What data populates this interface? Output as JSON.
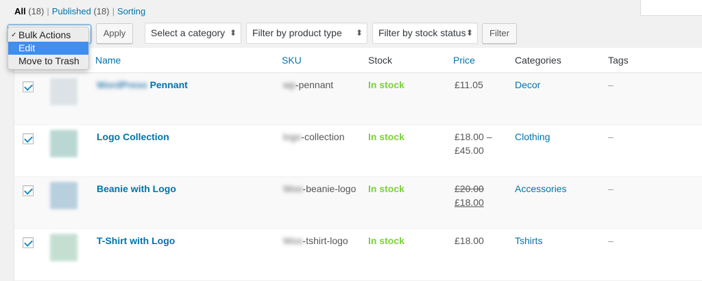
{
  "status_links": [
    {
      "label": "All",
      "count": "(18)",
      "current": true
    },
    {
      "label": "Published",
      "count": "(18)",
      "current": false
    },
    {
      "label": "Sorting",
      "count": "",
      "current": false
    }
  ],
  "toolbar": {
    "bulk_actions": {
      "options": [
        "Bulk Actions",
        "Edit",
        "Move to Trash"
      ],
      "selected": "Bulk Actions",
      "highlighted": "Edit"
    },
    "apply_label": "Apply",
    "category_filter": "Select a category",
    "type_filter": "Filter by product type",
    "stock_filter": "Filter by stock status",
    "filter_label": "Filter"
  },
  "columns": {
    "name": "Name",
    "sku": "SKU",
    "stock": "Stock",
    "price": "Price",
    "categories": "Categories",
    "tags": "Tags"
  },
  "products": [
    {
      "name_prefix": "WordPress",
      "name": "Pennant",
      "sku_prefix": "wp",
      "sku": "-pennant",
      "stock": "In stock",
      "price_line1": "£11.05",
      "price_line2": "",
      "sale_old": "",
      "sale_new": "",
      "category": "Decor",
      "tags": "–",
      "thumb_color": "#d7dde3"
    },
    {
      "name_prefix": "",
      "name": "Logo Collection",
      "sku_prefix": "logo",
      "sku": "-collection",
      "stock": "In stock",
      "price_line1": "£18.00 –",
      "price_line2": "£45.00",
      "sale_old": "",
      "sale_new": "",
      "category": "Clothing",
      "tags": "–",
      "thumb_color": "#a9cfc9"
    },
    {
      "name_prefix": "",
      "name": "Beanie with Logo",
      "sku_prefix": "Woo",
      "sku": "-beanie-logo",
      "stock": "In stock",
      "price_line1": "",
      "price_line2": "",
      "sale_old": "£20.00",
      "sale_new": "£18.00",
      "category": "Accessories",
      "tags": "–",
      "thumb_color": "#a8c6d8"
    },
    {
      "name_prefix": "",
      "name": "T-Shirt with Logo",
      "sku_prefix": "Woo",
      "sku": "-tshirt-logo",
      "stock": "In stock",
      "price_line1": "£18.00",
      "price_line2": "",
      "sale_old": "",
      "sale_new": "",
      "category": "Tshirts",
      "tags": "–",
      "thumb_color": "#b6d8c8"
    }
  ],
  "colors": {
    "link": "#0073aa",
    "in_stock": "#7ad03a",
    "menu_highlight": "#3f8ef0"
  }
}
